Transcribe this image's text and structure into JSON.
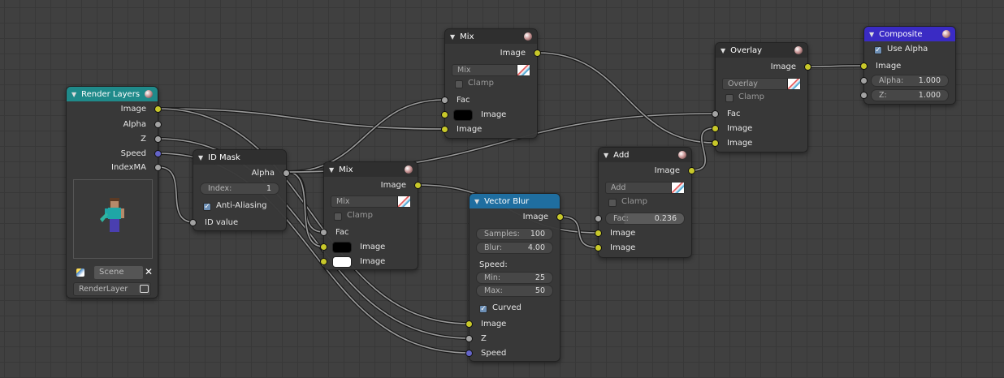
{
  "colors": {
    "image_socket": "#c8c82a",
    "value_socket": "#a2a2a2",
    "vector_socket": "#6464c8",
    "render_layers_header": "#1f8a8a",
    "vector_blur_header": "#1f6ea0",
    "composite_header": "#3a2bc4"
  },
  "render_layers": {
    "title": "Render Layers",
    "outputs": [
      "Image",
      "Alpha",
      "Z",
      "Speed",
      "IndexMA"
    ],
    "scene": "Scene",
    "layer": "RenderLayer"
  },
  "id_mask": {
    "title": "ID Mask",
    "output": "Alpha",
    "index_label": "Index:",
    "index_value": "1",
    "anti_aliasing": "Anti-Aliasing",
    "input": "ID value"
  },
  "mix_top": {
    "title": "Mix",
    "output": "Image",
    "mode": "Mix",
    "clamp": "Clamp",
    "fac": "Fac",
    "image1": "Image",
    "image2": "Image",
    "color1": "#000000"
  },
  "mix_mid": {
    "title": "Mix",
    "output": "Image",
    "mode": "Mix",
    "clamp": "Clamp",
    "fac": "Fac",
    "image1": "Image",
    "image2": "Image",
    "color1": "#000000",
    "color2": "#ffffff"
  },
  "vector_blur": {
    "title": "Vector Blur",
    "output": "Image",
    "samples_label": "Samples:",
    "samples": "100",
    "blur_label": "Blur:",
    "blur": "4.00",
    "speed_heading": "Speed:",
    "min_label": "Min:",
    "min": "25",
    "max_label": "Max:",
    "max": "50",
    "curved": "Curved",
    "inputs": [
      "Image",
      "Z",
      "Speed"
    ]
  },
  "add": {
    "title": "Add",
    "output": "Image",
    "mode": "Add",
    "clamp": "Clamp",
    "fac_label": "Fac:",
    "fac": "0.236",
    "fac_value": 0.236,
    "image1": "Image",
    "image2": "Image"
  },
  "overlay": {
    "title": "Overlay",
    "output": "Image",
    "mode": "Overlay",
    "clamp": "Clamp",
    "fac": "Fac",
    "image1": "Image",
    "image2": "Image"
  },
  "composite": {
    "title": "Composite",
    "use_alpha": "Use Alpha",
    "image": "Image",
    "alpha_label": "Alpha:",
    "alpha": "1.000",
    "z_label": "Z:",
    "z": "1.000"
  }
}
